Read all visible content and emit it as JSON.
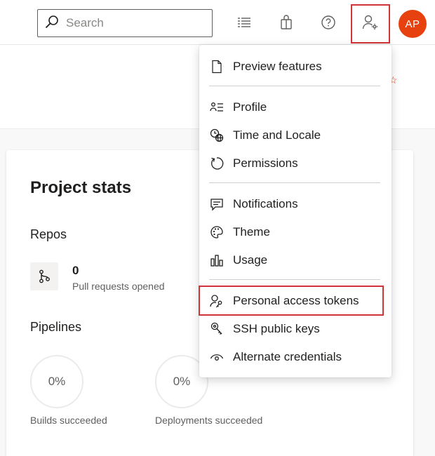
{
  "topbar": {
    "search_placeholder": "Search",
    "icons": [
      "search-icon",
      "task-list-icon",
      "marketplace-bag-icon",
      "help-icon",
      "user-settings-icon"
    ],
    "avatar_initials": "AP",
    "avatar_color": "#e6410e",
    "highlight_color": "#d13438"
  },
  "card": {
    "title": "Project stats",
    "repos": {
      "title": "Repos",
      "count": "0",
      "label": "Pull requests opened"
    },
    "pipelines": {
      "title": "Pipelines",
      "builds": {
        "value": "0%",
        "label": "Builds succeeded"
      },
      "deployments": {
        "value": "0%",
        "label": "Deployments succeeded"
      }
    }
  },
  "menu": {
    "items": [
      {
        "label": "Preview features",
        "icon": "document-icon"
      },
      {
        "label": "Profile",
        "icon": "profile-card-icon"
      },
      {
        "label": "Time and Locale",
        "icon": "clock-globe-icon"
      },
      {
        "label": "Permissions",
        "icon": "refresh-circle-icon"
      },
      {
        "label": "Notifications",
        "icon": "chat-bubble-icon"
      },
      {
        "label": "Theme",
        "icon": "palette-icon"
      },
      {
        "label": "Usage",
        "icon": "bar-chart-icon"
      },
      {
        "label": "Personal access tokens",
        "icon": "person-key-icon"
      },
      {
        "label": "SSH public keys",
        "icon": "key-icon"
      },
      {
        "label": "Alternate credentials",
        "icon": "eye-icon"
      }
    ]
  }
}
